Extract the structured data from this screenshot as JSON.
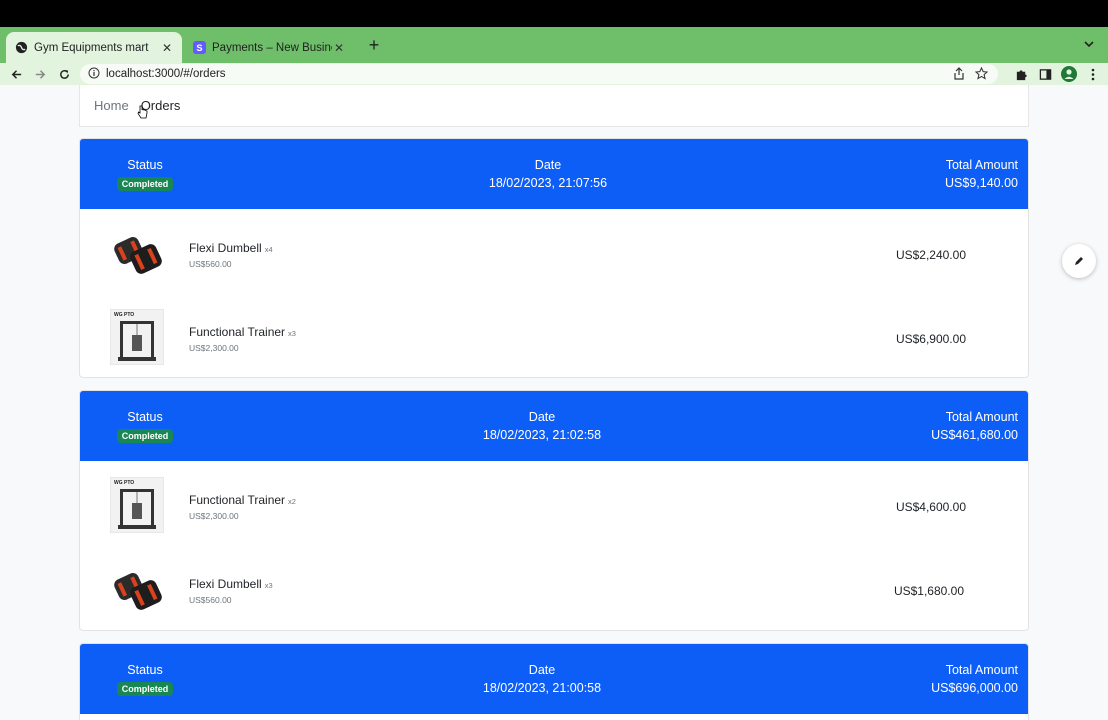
{
  "browser": {
    "tabs": [
      {
        "title": "Gym Equipments mart",
        "active": true,
        "icon": "globe-icon"
      },
      {
        "title": "Payments – New Business – St",
        "active": false,
        "icon": "stripe-icon"
      }
    ],
    "url": "localhost:3000/#/orders"
  },
  "breadcrumb": {
    "home": "Home",
    "current": "Orders"
  },
  "labels": {
    "status": "Status",
    "date": "Date",
    "total": "Total Amount"
  },
  "orders": [
    {
      "status": "Completed",
      "date": "18/02/2023, 21:07:56",
      "total": "US$9,140.00",
      "items": [
        {
          "name": "Flexi Dumbell",
          "qty": "x4",
          "unit_price": "US$560.00",
          "line_total": "US$2,240.00",
          "image": "dumbbell"
        },
        {
          "name": "Functional Trainer",
          "qty": "x3",
          "unit_price": "US$2,300.00",
          "line_total": "US$6,900.00",
          "image": "trainer"
        }
      ]
    },
    {
      "status": "Completed",
      "date": "18/02/2023, 21:02:58",
      "total": "US$461,680.00",
      "items": [
        {
          "name": "Functional Trainer",
          "qty": "x2",
          "unit_price": "US$2,300.00",
          "line_total": "US$4,600.00",
          "image": "trainer"
        },
        {
          "name": "Flexi Dumbell",
          "qty": "x3",
          "unit_price": "US$560.00",
          "line_total": "US$1,680.00",
          "image": "dumbbell"
        }
      ]
    },
    {
      "status": "Completed",
      "date": "18/02/2023, 21:00:58",
      "total": "US$696,000.00",
      "items": []
    }
  ],
  "colors": {
    "header_blue": "#0d5ef7",
    "badge_green": "#198754",
    "tabstrip_green": "#6fbf6a"
  }
}
